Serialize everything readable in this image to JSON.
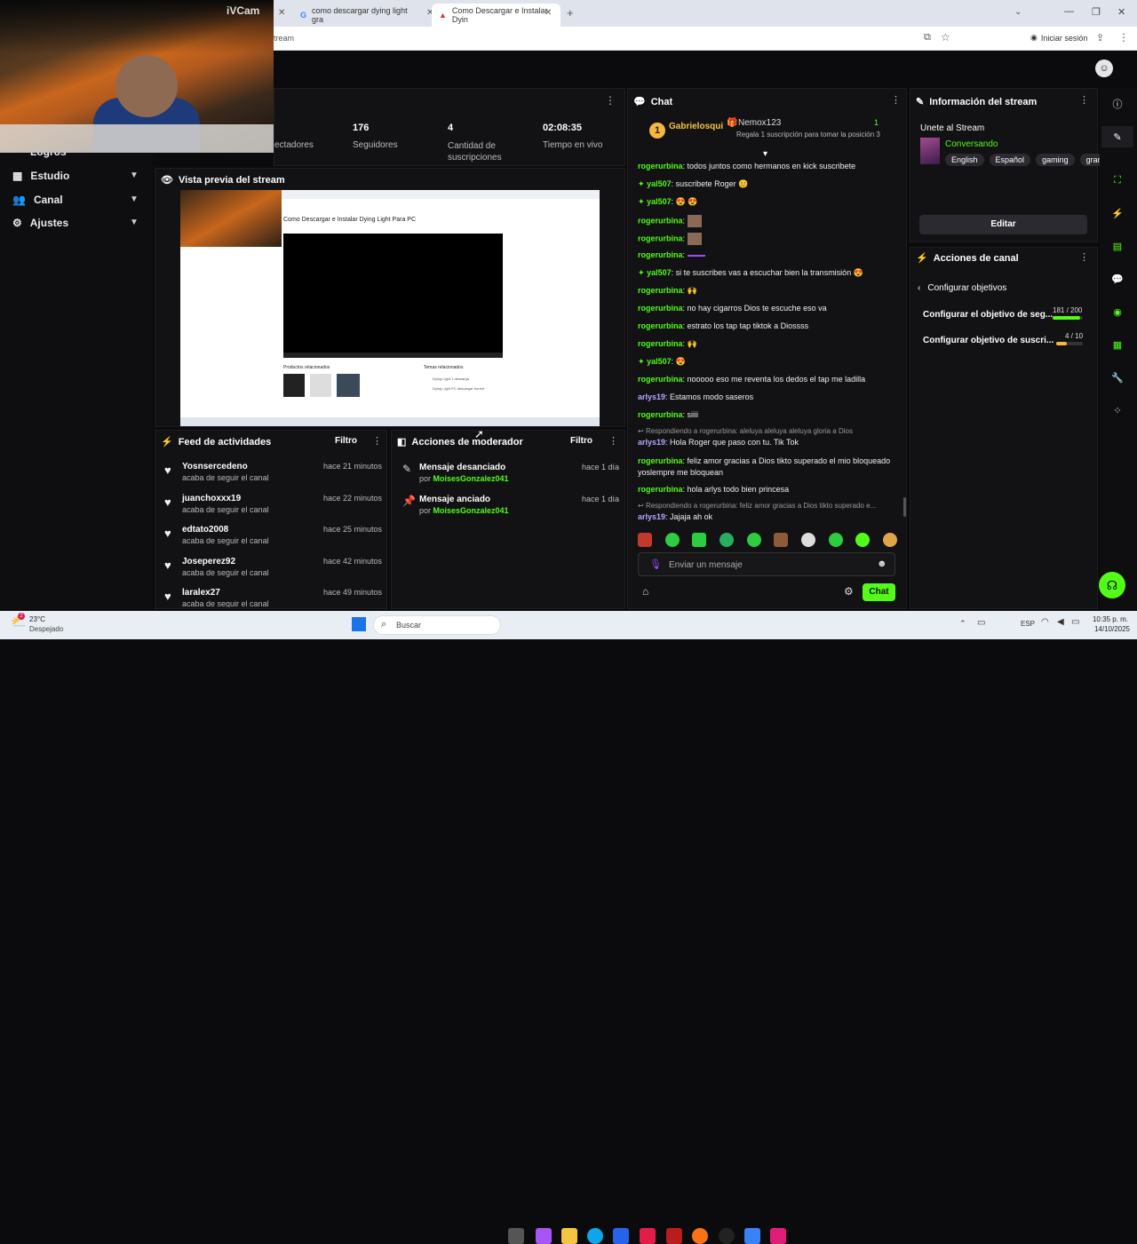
{
  "browser": {
    "tabs": [
      {
        "label": "como descargar dying light gra"
      },
      {
        "label": "Como Descargar e Instalar Dyin"
      }
    ],
    "url": "tream",
    "signin": "Iniciar sesión"
  },
  "webcam": {
    "label": "iVCam"
  },
  "nav": {
    "partial": "Logros",
    "items": [
      {
        "label": "Estudio"
      },
      {
        "label": "Canal"
      },
      {
        "label": "Ajustes"
      }
    ]
  },
  "stats": [
    {
      "value": "",
      "label": "ectadores"
    },
    {
      "value": "176",
      "label": "Seguidores"
    },
    {
      "value": "4",
      "label": "Cantidad de suscripciones"
    },
    {
      "value": "02:08:35",
      "label": "Tiempo en vivo"
    }
  ],
  "preview": {
    "title": "Vista previa del stream",
    "video_title": "Como Descargar e Instalar Dying Light Para PC",
    "related_products": "Productos relacionados",
    "related_topics": "Temas relacionados",
    "topic1": "Dying Light 1 descarga",
    "topic2": "Dying Light PC descargar torrent"
  },
  "feed": {
    "title": "Feed de actividades",
    "filter": "Filtro",
    "items": [
      {
        "name": "Yosnsercedeno",
        "action": "acaba de seguir el canal",
        "time": "hace 21 minutos"
      },
      {
        "name": "juanchoxxx19",
        "action": "acaba de seguir el canal",
        "time": "hace 22 minutos"
      },
      {
        "name": "edtato2008",
        "action": "acaba de seguir el canal",
        "time": "hace 25 minutos"
      },
      {
        "name": "Joseperez92",
        "action": "acaba de seguir el canal",
        "time": "hace 42 minutos"
      },
      {
        "name": "laralex27",
        "action": "acaba de seguir el canal",
        "time": "hace 49 minutos"
      }
    ]
  },
  "mod": {
    "title": "Acciones de moderador",
    "filter": "Filtro",
    "items": [
      {
        "title": "Mensaje desanciado",
        "by": "por",
        "user": "MoisesGonzalez041",
        "time": "hace 1 día"
      },
      {
        "title": "Mensaje anciado",
        "by": "por",
        "user": "MoisesGonzalez041",
        "time": "hace 1 día"
      }
    ]
  },
  "chat": {
    "title": "Chat",
    "pinned": {
      "rank": "1",
      "user": "Gabrielosqui",
      "user2": "Nemox123",
      "count": "1",
      "promo": "Regala 1 suscripción para tomar la posición 3"
    },
    "messages": [
      {
        "user": "rogerurbina",
        "text": "todos juntos como hermanos en kick suscribete"
      },
      {
        "user": "yal507",
        "text": "suscribete Roger 😊"
      },
      {
        "user": "yal507",
        "text": "😍 😍"
      },
      {
        "user": "rogerurbina",
        "text": ""
      },
      {
        "user": "rogerurbina",
        "text": ""
      },
      {
        "user": "rogerurbina",
        "text": ""
      },
      {
        "user": "yal507",
        "text": "si te suscribes vas a escuchar bien la transmisión 😍"
      },
      {
        "user": "rogerurbina",
        "text": "🙌"
      },
      {
        "user": "rogerurbina",
        "text": "no hay cigarros Dios te escuche eso va"
      },
      {
        "user": "rogerurbina",
        "text": "estrato los tap tap tiktok a Diossss"
      },
      {
        "user": "rogerurbina",
        "text": "🙌"
      },
      {
        "user": "yal507",
        "text": "😍"
      },
      {
        "user": "rogerurbina",
        "text": "nooooo eso me reventa los dedos el tap me ladilla"
      },
      {
        "user": "arlys19",
        "text": "Estamos modo saseros"
      },
      {
        "user": "rogerurbina",
        "text": "siiii"
      },
      {
        "reply": "Respondiendo a rogerurbina: aleluya aleluya aleluya gloria a Dios"
      },
      {
        "user": "arlys19",
        "text": "Hola Roger que paso con tu. Tik Tok"
      },
      {
        "user": "rogerurbina",
        "text": "feliz amor gracias a Dios tikto superado el mio bloqueado yoslempre me bloquean"
      },
      {
        "user": "rogerurbina",
        "text": "hola arlys todo bien princesa"
      },
      {
        "reply": "Respondiendo a rogerurbina: feliz amor gracias a Dios tikto superado e..."
      },
      {
        "user": "arlys19",
        "text": "Jajaja ah ok"
      }
    ],
    "input_placeholder": "Enviar un mensaje",
    "send": "Chat"
  },
  "info": {
    "title": "Información del stream",
    "stream_title": "Unete al Stream",
    "category": "Conversando",
    "tags": [
      "English",
      "Español",
      "gaming",
      "granj"
    ],
    "edit": "Editar"
  },
  "channel": {
    "title": "Acciones de canal",
    "back": "Configurar objetivos",
    "goals": [
      {
        "label": "Configurar el objetivo de seg...",
        "progress": "181 / 200",
        "fraction": 0.905,
        "color": "#53fc18"
      },
      {
        "label": "Configurar objetivo de suscri...",
        "progress": "4 / 10",
        "fraction": 0.4,
        "color": "#f5b642"
      }
    ]
  },
  "taskbar": {
    "weather_temp": "23°C",
    "weather_desc": "Despejado",
    "search": "Buscar",
    "lang": "ESP",
    "time": "10:35 p. m.",
    "date": "14/10/2025"
  }
}
